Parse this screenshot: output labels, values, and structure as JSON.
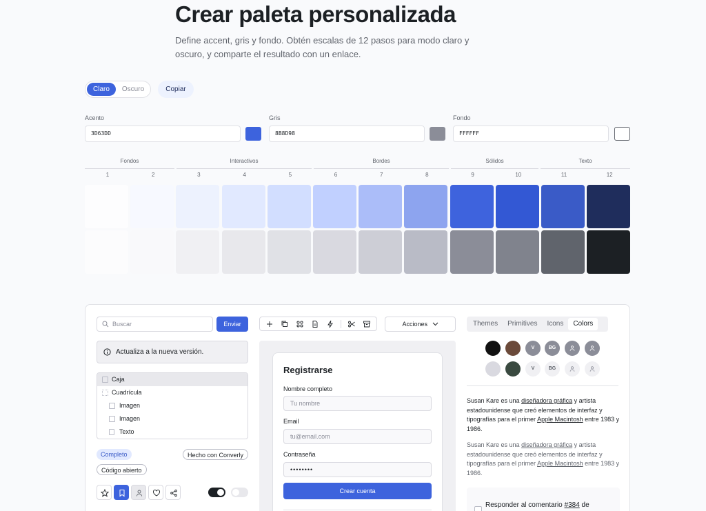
{
  "header": {
    "title": "Crear paleta personalizada",
    "subtitle": "Define accent, gris y fondo. Obtén escalas de 12 pasos para modo claro y oscuro, y comparte el resultado con un enlace."
  },
  "mode": {
    "light": "Claro",
    "dark": "Oscuro",
    "copy": "Copiar"
  },
  "fields": {
    "accent": {
      "label": "Acento",
      "value": "3D63DD",
      "color": "#3D63DD"
    },
    "gray": {
      "label": "Gris",
      "value": "8B8D98",
      "color": "#8B8D98"
    },
    "background": {
      "label": "Fondo",
      "value": "FFFFFF",
      "color": "#FFFFFF"
    }
  },
  "scale": {
    "groups": [
      "Fondos",
      "Interactivos",
      "Bordes",
      "Sólidos",
      "Texto"
    ],
    "steps": [
      "1",
      "2",
      "3",
      "4",
      "5",
      "6",
      "7",
      "8",
      "9",
      "10",
      "11",
      "12"
    ],
    "accent_colors": [
      "#fdfdfe",
      "#f7f9ff",
      "#edf2fe",
      "#e1e9ff",
      "#d2deff",
      "#c1d0ff",
      "#abbdf9",
      "#8da4ef",
      "#3e63dd",
      "#3358d4",
      "#3a5bc7",
      "#1f2d5c"
    ],
    "gray_colors": [
      "#fcfcfd",
      "#f9f9fb",
      "#f0f0f3",
      "#e8e8ec",
      "#e0e1e6",
      "#d9d9e0",
      "#cdced6",
      "#b9bbc6",
      "#8b8d98",
      "#80838d",
      "#60646c",
      "#1c2024"
    ]
  },
  "demo": {
    "search_placeholder": "Buscar",
    "send": "Enviar",
    "callout": "Actualiza a la nueva versión.",
    "tree": [
      "Caja",
      "Cuadrícula",
      "Imagen",
      "Imagen",
      "Texto"
    ],
    "badges": {
      "complete": "Completo",
      "made_with": "Hecho con Converly",
      "open_source": "Código abierto"
    },
    "actions": "Acciones",
    "form": {
      "title": "Registrarse",
      "name_label": "Nombre completo",
      "name_placeholder": "Tu nombre",
      "email_label": "Email",
      "email_placeholder": "tu@email.com",
      "password_label": "Contraseña",
      "password_value": "••••••••",
      "submit": "Crear cuenta"
    },
    "tabs": [
      "Themes",
      "Primitives",
      "Icons",
      "Colors"
    ],
    "avatars": {
      "v": "V",
      "bg": "BG"
    },
    "paragraph": {
      "p1": "Susan Kare es una ",
      "link1": "diseñadora gráfica",
      "p2": " y artista estadounidense que creó elementos de interfaz y tipografías para el primer ",
      "link2": "Apple Macintosh",
      "p3": " entre 1983 y 1986."
    },
    "comment": {
      "prefix": "Responder al comentario ",
      "link": "#384",
      "suffix": " de"
    }
  }
}
